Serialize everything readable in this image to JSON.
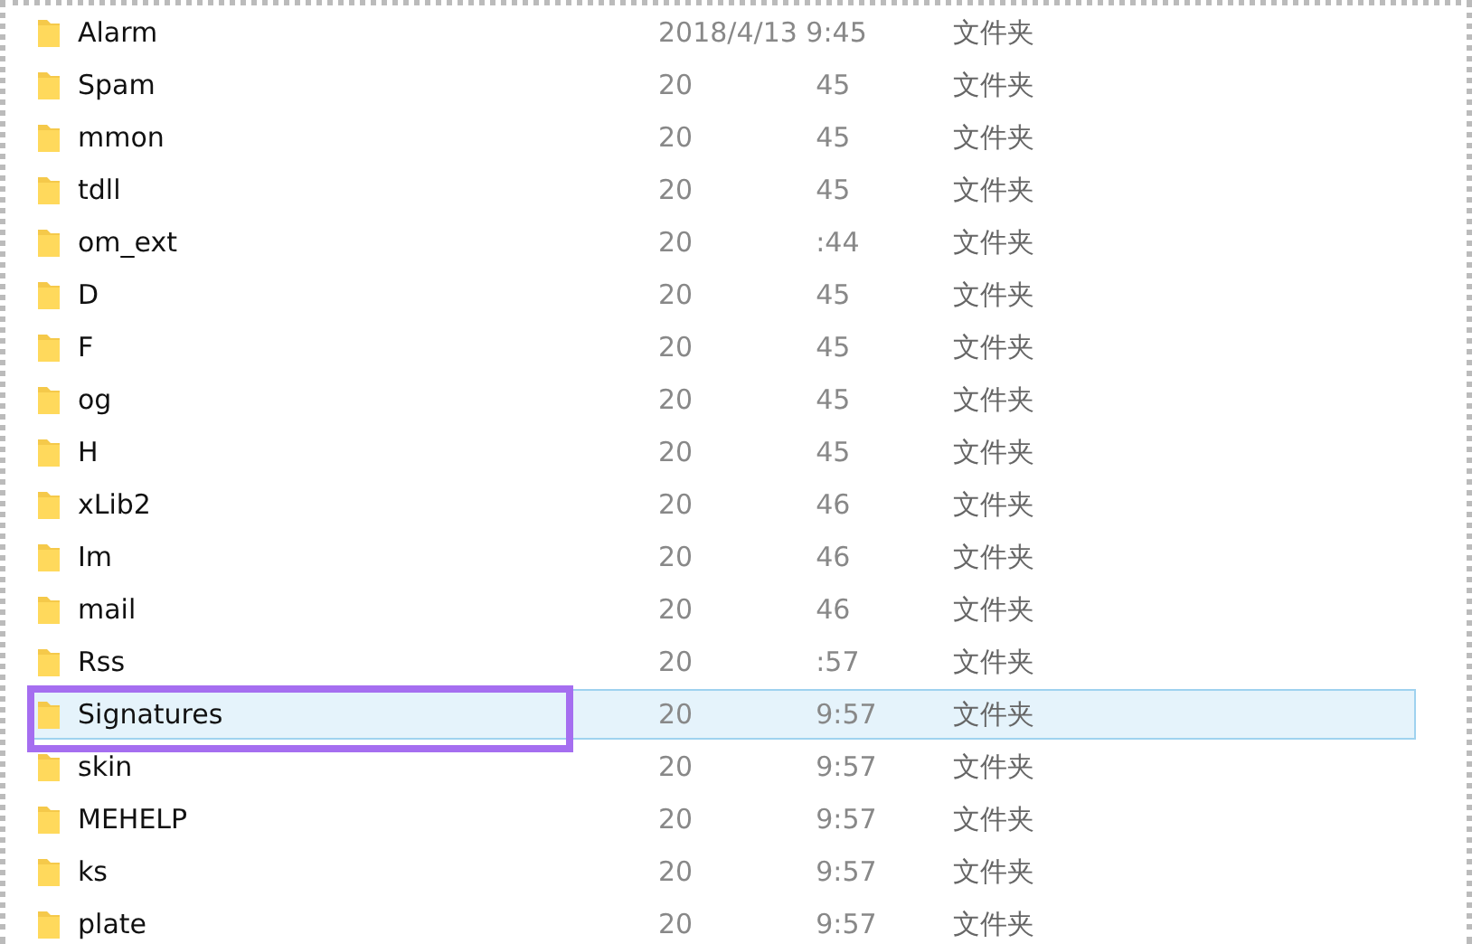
{
  "files": [
    {
      "name": "Alarm",
      "date": "2018/4/13 9:45",
      "type": "文件夹",
      "selected": false
    },
    {
      "name": "Spam",
      "date": "20",
      "time": "45",
      "type": "文件夹",
      "selected": false
    },
    {
      "name": "mmon",
      "date": "20",
      "time": "45",
      "type": "文件夹",
      "selected": false
    },
    {
      "name": "tdll",
      "date": "20",
      "time": "45",
      "type": "文件夹",
      "selected": false
    },
    {
      "name": "om_ext",
      "date": "20",
      "time": ":44",
      "type": "文件夹",
      "selected": false
    },
    {
      "name": "D",
      "date": "20",
      "time": "45",
      "type": "文件夹",
      "selected": false
    },
    {
      "name": "F",
      "date": "20",
      "time": "45",
      "type": "文件夹",
      "selected": false
    },
    {
      "name": "og",
      "date": "20",
      "time": "45",
      "type": "文件夹",
      "selected": false
    },
    {
      "name": "H",
      "date": "20",
      "time": "45",
      "type": "文件夹",
      "selected": false
    },
    {
      "name": "xLib2",
      "date": "20",
      "time": "46",
      "type": "文件夹",
      "selected": false
    },
    {
      "name": "Im",
      "date": "20",
      "time": "46",
      "type": "文件夹",
      "selected": false
    },
    {
      "name": "mail",
      "date": "20",
      "time": "46",
      "type": "文件夹",
      "selected": false
    },
    {
      "name": "Rss",
      "date": "20",
      "time": ":57",
      "type": "文件夹",
      "selected": false
    },
    {
      "name": "Signatures",
      "date": "20",
      "time": "9:57",
      "type": "文件夹",
      "selected": true,
      "highlighted": true
    },
    {
      "name": "skin",
      "date": "20",
      "time": "9:57",
      "type": "文件夹",
      "selected": false
    },
    {
      "name": "MEHELP",
      "date": "20",
      "time": "9:57",
      "type": "文件夹",
      "selected": false
    },
    {
      "name": "ks",
      "date": "20",
      "time": "9:57",
      "type": "文件夹",
      "selected": false
    },
    {
      "name": "plate",
      "date": "20",
      "time": "9:57",
      "type": "文件夹",
      "selected": false
    }
  ]
}
